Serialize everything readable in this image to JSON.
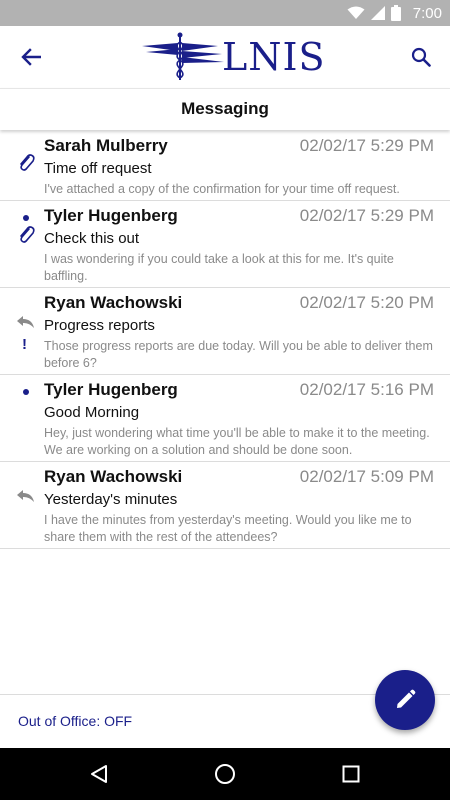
{
  "status_bar": {
    "time": "7:00",
    "icons": [
      "wifi-icon",
      "signal-icon",
      "battery-icon"
    ]
  },
  "header": {
    "logo_text": "LNIS",
    "back_icon": "arrow-left-icon",
    "search_icon": "search-icon"
  },
  "subheader": {
    "title": "Messaging"
  },
  "messages": [
    {
      "sender": "Sarah Mulberry",
      "date": "02/02/17 5:29 PM",
      "subject": "Time off request",
      "preview": "I've attached a copy of the confirmation for your time off request.",
      "unread": false,
      "attachment": true,
      "replied": false,
      "important": false
    },
    {
      "sender": "Tyler Hugenberg",
      "date": "02/02/17 5:29 PM",
      "subject": "Check this out",
      "preview": "I was wondering if you could take a look at this for me. It's quite baffling.",
      "unread": true,
      "attachment": true,
      "replied": false,
      "important": false
    },
    {
      "sender": "Ryan Wachowski",
      "date": "02/02/17 5:20 PM",
      "subject": "Progress reports",
      "preview": "Those progress reports are due today. Will you be able to deliver them before 6?",
      "unread": false,
      "attachment": false,
      "replied": true,
      "important": true
    },
    {
      "sender": "Tyler Hugenberg",
      "date": "02/02/17 5:16 PM",
      "subject": "Good Morning",
      "preview": "Hey, just wondering what time you'll be able to make it to the meeting. We are working on a solution and should be done soon.",
      "unread": true,
      "attachment": false,
      "replied": false,
      "important": false
    },
    {
      "sender": "Ryan Wachowski",
      "date": "02/02/17 5:09 PM",
      "subject": "Yesterday's minutes",
      "preview": "I have the minutes from yesterday's meeting. Would you like me to share them with the rest of the attendees?",
      "unread": false,
      "attachment": false,
      "replied": true,
      "important": false
    }
  ],
  "footer": {
    "out_of_office": "Out of Office: OFF"
  },
  "fab": {
    "icon": "pencil-icon"
  },
  "nav_bar": {
    "icons": [
      "back-triangle-icon",
      "home-circle-icon",
      "recents-square-icon"
    ]
  },
  "colors": {
    "brand": "#1a1f8a",
    "status_bar": "#b2b2b2",
    "meta_text": "#8a8a8a"
  }
}
